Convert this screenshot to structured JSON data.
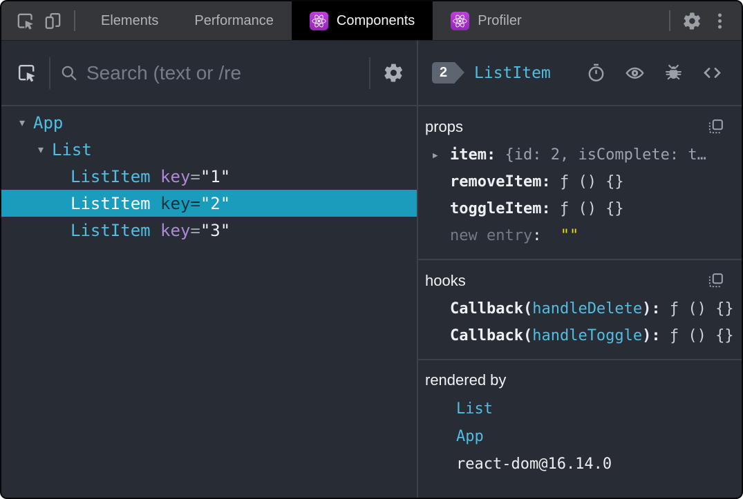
{
  "colors": {
    "panel_bg": "#282c34",
    "tabbar_bg": "#35363a",
    "divider": "#3c414a",
    "component_cyan": "#52bde2",
    "key_purple": "#b088d8",
    "selected_row_bg": "#1a9cbd",
    "selected_key_dark": "#14323d",
    "string_yellow": "#e8df13",
    "react_icon_purple": "#a82cc4",
    "badge_gray": "#5d6570"
  },
  "tabbar": {
    "tabs": [
      {
        "label": "Elements",
        "active": false,
        "react_icon": false
      },
      {
        "label": "Performance",
        "active": false,
        "react_icon": false
      },
      {
        "label": "Components",
        "active": true,
        "react_icon": true
      },
      {
        "label": "Profiler",
        "active": false,
        "react_icon": true
      }
    ]
  },
  "left_panel": {
    "search_placeholder": "Search (text or /re",
    "tree": [
      {
        "name": "App",
        "depth": 0,
        "expanded": true,
        "selected": false
      },
      {
        "name": "List",
        "depth": 1,
        "expanded": true,
        "selected": false
      },
      {
        "name": "ListItem",
        "attr": "key",
        "eq": "=",
        "value": "\"1\"",
        "depth": 2,
        "selected": false
      },
      {
        "name": "ListItem",
        "attr": "key",
        "eq": "=",
        "value": "\"2\"",
        "depth": 2,
        "selected": true
      },
      {
        "name": "ListItem",
        "attr": "key",
        "eq": "=",
        "value": "\"3\"",
        "depth": 2,
        "selected": false
      }
    ]
  },
  "right_panel": {
    "header": {
      "badge": "2",
      "component_name": "ListItem",
      "icons": [
        "timer-icon",
        "eye-icon",
        "bug-icon",
        "view-source-icon"
      ]
    },
    "sections": [
      {
        "title": "props",
        "copy_icon": true,
        "rows": [
          {
            "style": "object",
            "expandable": true,
            "name": "item",
            "separator": ": ",
            "value": "{id: 2, isComplete: t…"
          },
          {
            "style": "function",
            "name": "removeItem",
            "separator": ": ",
            "value": "ƒ () {}"
          },
          {
            "style": "function",
            "name": "toggleItem",
            "separator": ": ",
            "value": "ƒ () {}"
          },
          {
            "style": "new-entry",
            "name": "new entry",
            "separator": ": ",
            "value": "\"\""
          }
        ]
      },
      {
        "title": "hooks",
        "copy_icon": true,
        "rows": [
          {
            "style": "hook",
            "name": "Callback",
            "open_paren": "(",
            "hook": "handleDelete",
            "close_paren": ")",
            "separator": ": ",
            "value": "ƒ () {}"
          },
          {
            "style": "hook",
            "name": "Callback",
            "open_paren": "(",
            "hook": "handleToggle",
            "close_paren": ")",
            "separator": ": ",
            "value": "ƒ () {}"
          }
        ]
      },
      {
        "title": "rendered by",
        "copy_icon": false,
        "rows": [
          {
            "style": "component-link",
            "name": "List"
          },
          {
            "style": "component-link",
            "name": "App"
          },
          {
            "style": "plain",
            "name": "react-dom@16.14.0"
          }
        ]
      }
    ]
  },
  "glyphs": {
    "expanded_arrow": "▾",
    "collapsed_arrow": "▸"
  }
}
